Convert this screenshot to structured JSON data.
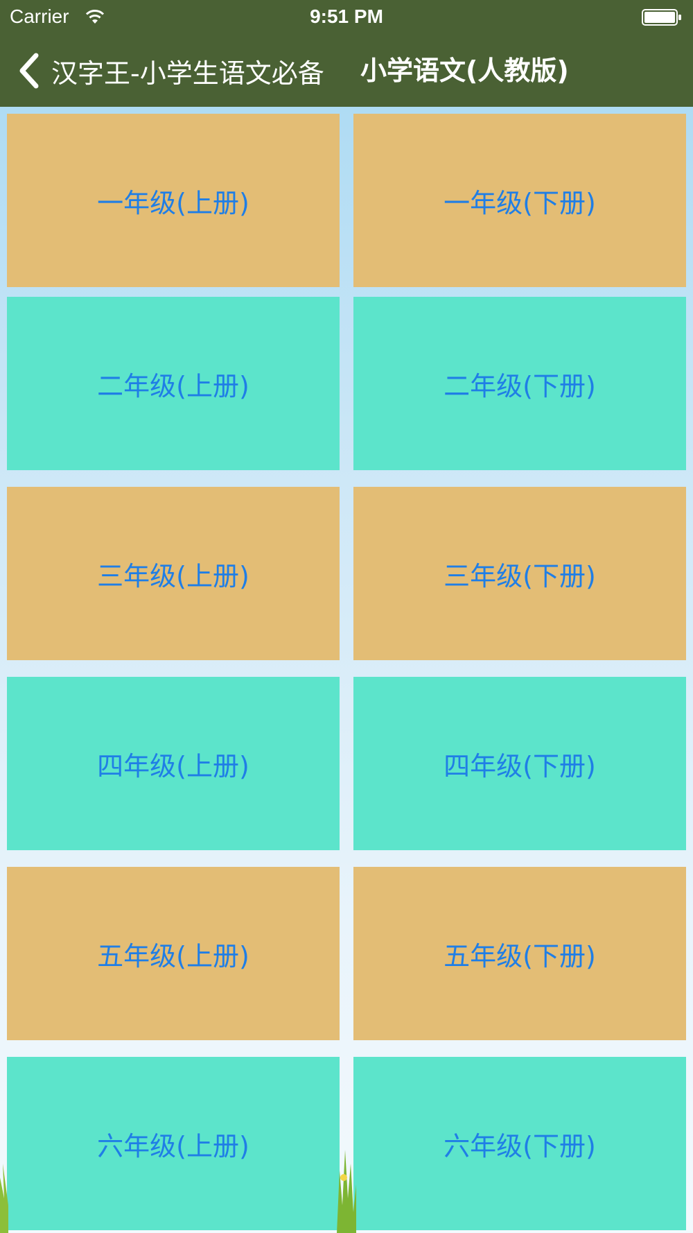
{
  "status": {
    "carrier": "Carrier",
    "time": "9:51 PM"
  },
  "nav": {
    "back_label": "汉字王-小学生语文必备",
    "title": "小学语文(人教版)"
  },
  "colors": {
    "bar": "#4a6134",
    "tile_orange": "#e3bd75",
    "tile_teal": "#5ce4cb",
    "tile_text": "#1f7ee6"
  },
  "grades": [
    {
      "left": "一年级(上册)",
      "right": "一年级(下册)"
    },
    {
      "left": "二年级(上册)",
      "right": "二年级(下册)"
    },
    {
      "left": "三年级(上册)",
      "right": "三年级(下册)"
    },
    {
      "left": "四年级(上册)",
      "right": "四年级(下册)"
    },
    {
      "left": "五年级(上册)",
      "right": "五年级(下册)"
    },
    {
      "left": "六年级(上册)",
      "right": "六年级(下册)"
    }
  ]
}
